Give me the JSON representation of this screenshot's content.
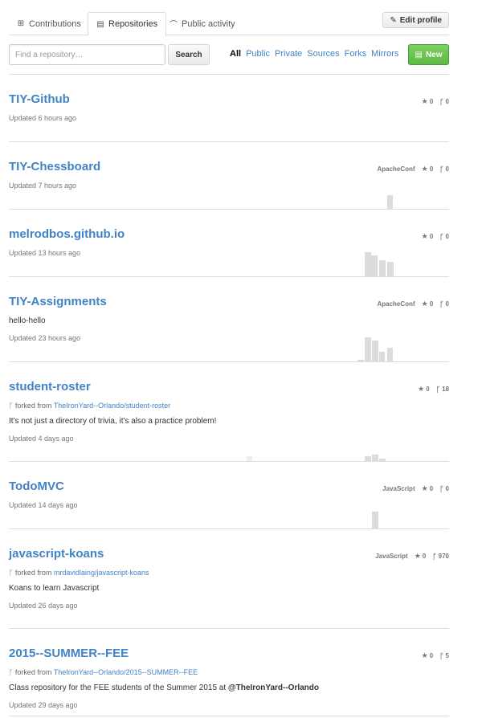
{
  "tabs": [
    {
      "label": "Contributions",
      "icon": "plus-square-icon",
      "glyph": "⊞",
      "selected": false
    },
    {
      "label": "Repositories",
      "icon": "repo-book-icon",
      "glyph": "▤",
      "selected": true
    },
    {
      "label": "Public activity",
      "icon": "rss-icon",
      "glyph": "⌒",
      "selected": false
    }
  ],
  "edit_profile_label": "Edit profile",
  "search": {
    "placeholder": "Find a repository…",
    "value": "",
    "button_label": "Search"
  },
  "filters": [
    {
      "label": "All",
      "active": true
    },
    {
      "label": "Public",
      "active": false
    },
    {
      "label": "Private",
      "active": false
    },
    {
      "label": "Sources",
      "active": false
    },
    {
      "label": "Forks",
      "active": false
    },
    {
      "label": "Mirrors",
      "active": false
    }
  ],
  "new_button_label": "New",
  "colors": {
    "link": "#4183c4",
    "new_button": "#6cc644",
    "bar": "#dcdcdc"
  },
  "repos": [
    {
      "name": "TIY-Github",
      "language": "",
      "stars": "0",
      "forks": "0",
      "forked_from": "",
      "description": "",
      "description_mention": "",
      "updated": "Updated 6 hours ago",
      "activity": []
    },
    {
      "name": "TIY-Chessboard",
      "language": "ApacheConf",
      "stars": "0",
      "forks": "0",
      "forked_from": "",
      "description": "",
      "description_mention": "",
      "updated": "Updated 7 hours ago",
      "activity": [
        0.55
      ]
    },
    {
      "name": "melrodbos.github.io",
      "language": "",
      "stars": "0",
      "forks": "0",
      "forked_from": "",
      "description": "",
      "description_mention": "",
      "updated": "Updated 13 hours ago",
      "activity": [
        1.0,
        0.85,
        0.65,
        0.6
      ]
    },
    {
      "name": "TIY-Assignments",
      "language": "ApacheConf",
      "stars": "0",
      "forks": "0",
      "forked_from": "",
      "description": "hello-hello",
      "description_mention": "",
      "updated": "Updated 23 hours ago",
      "activity": [
        0.05,
        1.0,
        0.85,
        0.4,
        0.55
      ]
    },
    {
      "name": "student-roster",
      "language": "",
      "stars": "0",
      "forks": "18",
      "forked_from": "TheIronYard--Orlando/student-roster",
      "description": "It's not just a directory of trivia, it's also a practice problem!",
      "description_mention": "",
      "updated": "Updated 4 days ago",
      "activity": [
        0.2,
        0.2,
        0.25,
        0.1
      ]
    },
    {
      "name": "TodoMVC",
      "language": "JavaScript",
      "stars": "0",
      "forks": "0",
      "forked_from": "",
      "description": "",
      "description_mention": "",
      "updated": "Updated 14 days ago",
      "activity": [
        0.7
      ]
    },
    {
      "name": "javascript-koans",
      "language": "JavaScript",
      "stars": "0",
      "forks": "970",
      "forked_from": "mrdavidlaing/javascript-koans",
      "description": "Koans to learn Javascript",
      "description_mention": "",
      "updated": "Updated 26 days ago",
      "activity": []
    },
    {
      "name": "2015--SUMMER--FEE",
      "language": "",
      "stars": "0",
      "forks": "5",
      "forked_from": "TheIronYard--Orlando/2015--SUMMER--FEE",
      "description": "Class repository for the FEE students of the Summer 2015 at ",
      "description_mention": "@TheIronYard--Orlando",
      "updated": "Updated 29 days ago",
      "activity": []
    }
  ],
  "labels": {
    "forked_from_prefix": "forked from "
  }
}
